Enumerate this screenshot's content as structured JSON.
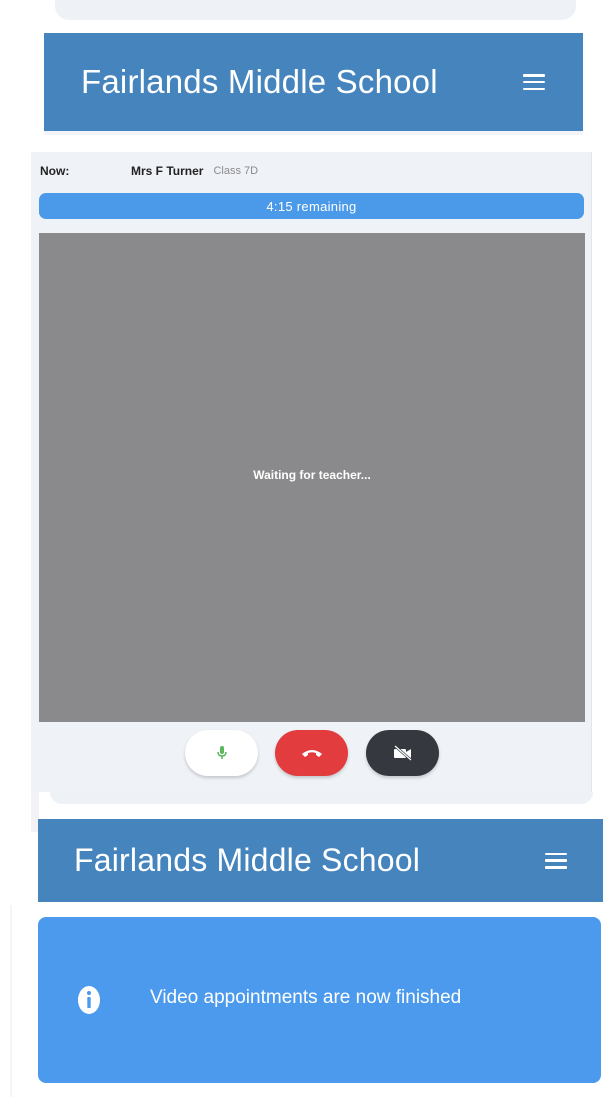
{
  "school_name": "Fairlands Middle School",
  "appointment": {
    "now_label": "Now:",
    "teacher": "Mrs F Turner",
    "class": "Class 7D",
    "remaining": "4:15 remaining",
    "video_status": "Waiting for teacher..."
  },
  "controls": {
    "mic_icon": "microphone-icon",
    "hangup_icon": "phone-hangup-icon",
    "camera_icon": "camera-off-icon"
  },
  "notice": {
    "icon": "info-icon",
    "message": "Video appointments are now finished"
  },
  "colors": {
    "header": "#4584bd",
    "timer": "#4a9ae9",
    "notice": "#4c9aed",
    "hangup": "#e23c3f",
    "mic": "#5cb85c",
    "camera_button": "#35393f"
  }
}
